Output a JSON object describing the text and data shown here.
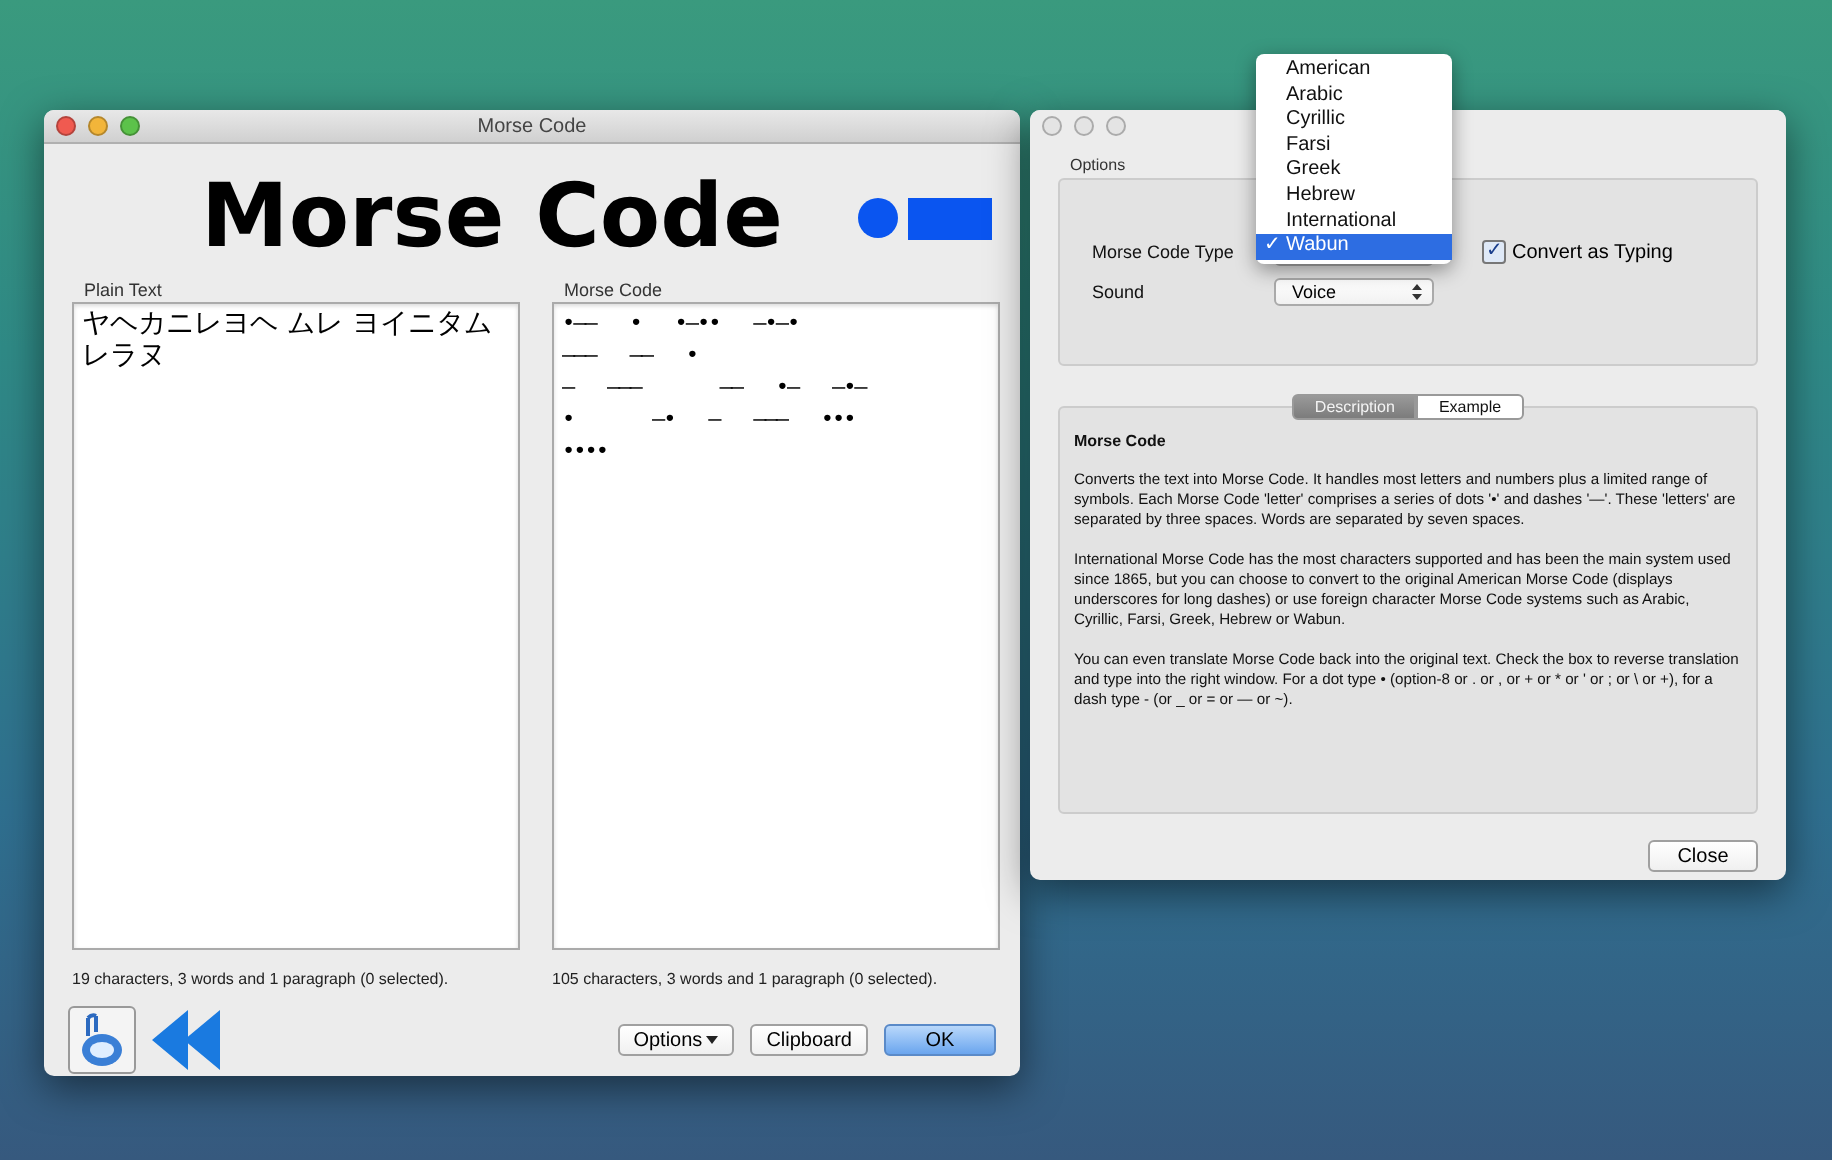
{
  "main_window": {
    "title": "Morse Code",
    "heading": "Morse Code",
    "plain_text": {
      "label": "Plain Text",
      "lines": [
        "ヤヘカニレヨヘ ムレ ヨイニタム",
        "レラヌ"
      ],
      "status": "19 characters, 3 words and 1 paragraph (0 selected)."
    },
    "morse_text": {
      "label": "Morse Code",
      "value": "•——   •   •—••   —•—•\n———   ——   •\n—   ———       ——   •—   —•—\n•       —•   —   ———   •••\n••••",
      "status": "105 characters, 3 words and 1 paragraph (0 selected)."
    },
    "buttons": [
      {
        "label": "Options",
        "kind": "menu"
      },
      {
        "label": "Clipboard",
        "kind": "plain"
      },
      {
        "label": "OK",
        "kind": "default"
      }
    ]
  },
  "options_window": {
    "group_label": "Options",
    "morse_code_type": {
      "label": "Morse Code Type"
    },
    "convert_as_typing": {
      "label": "Convert as Typing",
      "checked": true
    },
    "sound": {
      "label": "Sound",
      "value": "Voice"
    },
    "tabs": [
      {
        "label": "Description",
        "selected": true
      },
      {
        "label": "Example",
        "selected": false
      }
    ],
    "description": {
      "title": "Morse Code",
      "paragraphs": [
        "Converts the text into Morse Code. It handles most letters and numbers plus a limited range of symbols. Each Morse Code 'letter' comprises a series of dots '•' and dashes '—'. These 'letters' are separated by three spaces. Words are separated by seven spaces.",
        "International Morse Code has the most characters supported and has been the main system used since 1865, but you can choose to convert to the original American Morse Code (displays underscores for long dashes) or use foreign character Morse Code systems such as Arabic, Cyrillic, Farsi, Greek, Hebrew or Wabun.",
        "You can even translate Morse Code back into the original text. Check the box to reverse translation and type into the right window. For a dot type • (option-8 or . or , or + or * or ' or ; or \\ or +), for a dash type - (or _ or = or — or ~)."
      ]
    },
    "close_button": "Close"
  },
  "type_menu": {
    "items": [
      {
        "label": "American",
        "selected": false
      },
      {
        "label": "Arabic",
        "selected": false
      },
      {
        "label": "Cyrillic",
        "selected": false
      },
      {
        "label": "Farsi",
        "selected": false
      },
      {
        "label": "Greek",
        "selected": false
      },
      {
        "label": "Hebrew",
        "selected": false
      },
      {
        "label": "International",
        "selected": false
      },
      {
        "label": "Wabun",
        "selected": true
      }
    ],
    "check": "✓"
  }
}
